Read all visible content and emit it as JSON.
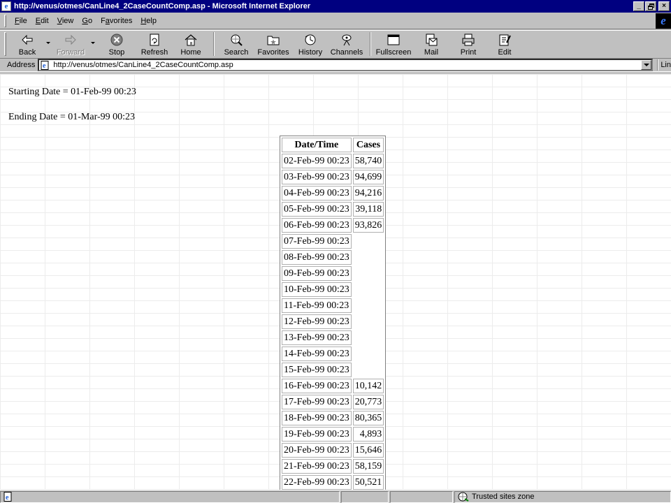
{
  "window": {
    "title": "http://venus/otmes/CanLine4_2CaseCountComp.asp - Microsoft Internet Explorer",
    "minimize": "_",
    "restore": "🗗",
    "close": "×",
    "app_icon": "e"
  },
  "menu": {
    "items": [
      {
        "label": "File",
        "key": "F"
      },
      {
        "label": "Edit",
        "key": "E"
      },
      {
        "label": "View",
        "key": "V"
      },
      {
        "label": "Go",
        "key": "G"
      },
      {
        "label": "Favorites",
        "key": "a"
      },
      {
        "label": "Help",
        "key": "H"
      }
    ]
  },
  "toolbar": {
    "back": "Back",
    "forward": "Forward",
    "stop": "Stop",
    "refresh": "Refresh",
    "home": "Home",
    "search": "Search",
    "favorites": "Favorites",
    "history": "History",
    "channels": "Channels",
    "fullscreen": "Fullscreen",
    "mail": "Mail",
    "print": "Print",
    "edit": "Edit"
  },
  "address": {
    "label": "Address",
    "url": "http://venus/otmes/CanLine4_2CaseCountComp.asp",
    "links_label": "Lin"
  },
  "page": {
    "starting": "Starting Date = 01-Feb-99 00:23",
    "ending": "Ending Date = 01-Mar-99 00:23",
    "table": {
      "headers": [
        "Date/Time",
        "Cases"
      ],
      "rows": [
        [
          "02-Feb-99 00:23",
          "58,740"
        ],
        [
          "03-Feb-99 00:23",
          "94,699"
        ],
        [
          "04-Feb-99 00:23",
          "94,216"
        ],
        [
          "05-Feb-99 00:23",
          "39,118"
        ],
        [
          "06-Feb-99 00:23",
          "93,826"
        ],
        [
          "07-Feb-99 00:23",
          ""
        ],
        [
          "08-Feb-99 00:23",
          ""
        ],
        [
          "09-Feb-99 00:23",
          ""
        ],
        [
          "10-Feb-99 00:23",
          ""
        ],
        [
          "11-Feb-99 00:23",
          ""
        ],
        [
          "12-Feb-99 00:23",
          ""
        ],
        [
          "13-Feb-99 00:23",
          ""
        ],
        [
          "14-Feb-99 00:23",
          ""
        ],
        [
          "15-Feb-99 00:23",
          ""
        ],
        [
          "16-Feb-99 00:23",
          "10,142"
        ],
        [
          "17-Feb-99 00:23",
          "20,773"
        ],
        [
          "18-Feb-99 00:23",
          "80,365"
        ],
        [
          "19-Feb-99 00:23",
          "4,893"
        ],
        [
          "20-Feb-99 00:23",
          "15,646"
        ],
        [
          "21-Feb-99 00:23",
          "58,159"
        ],
        [
          "22-Feb-99 00:23",
          "50,521"
        ]
      ]
    }
  },
  "status": {
    "zone": "Trusted sites zone"
  },
  "colors": {
    "titlebar": "#000080",
    "chrome": "#c0c0c0",
    "ie_blue": "#1c5bd6"
  }
}
